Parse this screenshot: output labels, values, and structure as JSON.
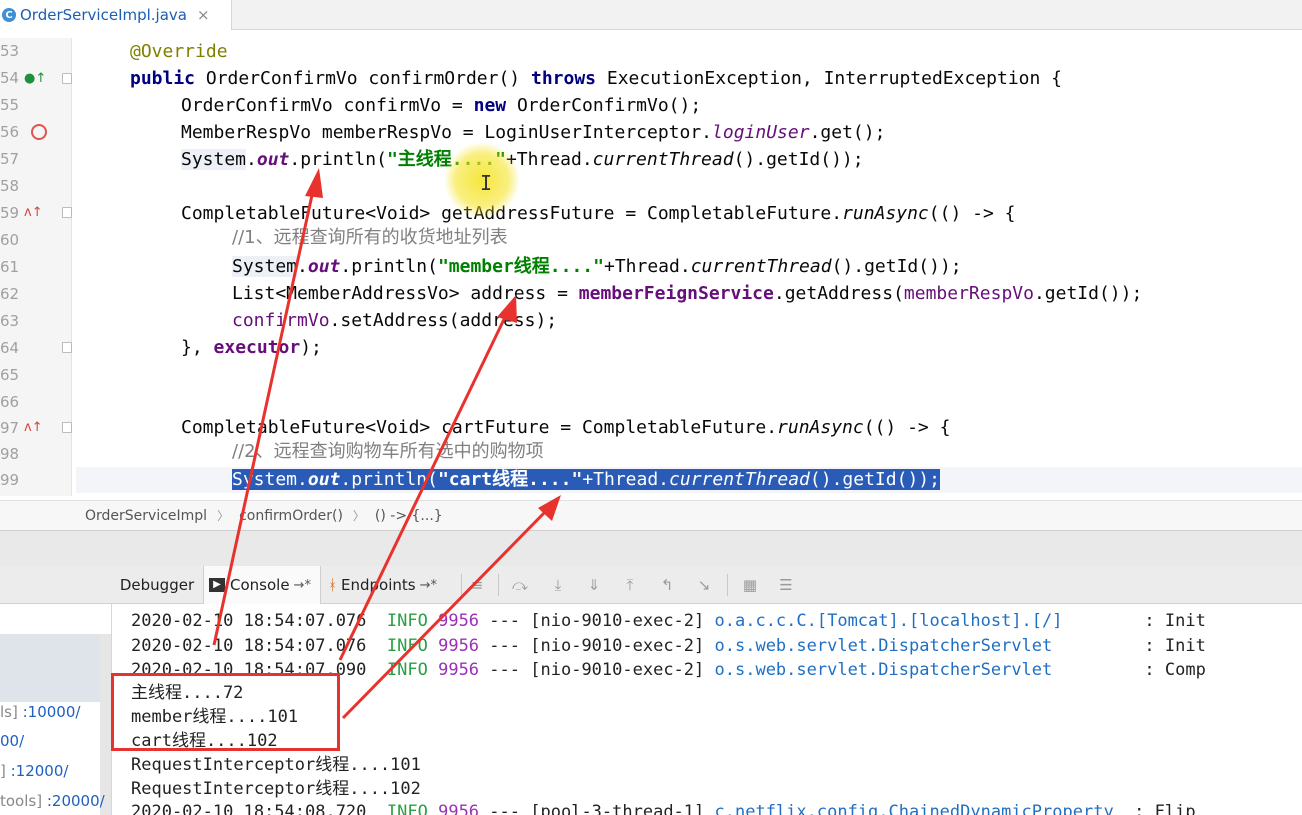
{
  "tab": {
    "icon": "C",
    "label": "OrderServiceImpl.java",
    "close": "×"
  },
  "gutter": {
    "numbers": [
      "53",
      "54",
      "55",
      "56",
      "57",
      "58",
      "59",
      "60",
      "61",
      "62",
      "63",
      "64",
      "65",
      "66",
      "97",
      "98",
      "99"
    ]
  },
  "code": {
    "l1": {
      "ann": "@Override"
    },
    "l2": {
      "kw1": "public",
      "t1": " OrderConfirmVo confirmOrder() ",
      "kw2": "throws",
      "t2": " ExecutionException, InterruptedException {"
    },
    "l3": {
      "t1": "OrderConfirmVo confirmVo = ",
      "kw": "new",
      "t2": " OrderConfirmVo();"
    },
    "l4": {
      "t1": "MemberRespVo memberRespVo = LoginUserInterceptor.",
      "it": "loginUser",
      "t2": ".get();"
    },
    "l5": {
      "sys": "System",
      "dot": ".",
      "fld": "out",
      "t1": ".println(",
      "str": "\"主线程....\"",
      "t2": "+Thread.",
      "it": "currentThread",
      "t3": "().getId());"
    },
    "l7": {
      "t1": "CompletableFuture<Void> getAddressFuture = CompletableFuture.",
      "it": "runAsync",
      "t2": "(() -> {"
    },
    "l8": {
      "cmt": "//1、远程查询所有的收货地址列表"
    },
    "l9": {
      "sys": "System",
      "dot": ".",
      "fld": "out",
      "t1": ".println(",
      "str": "\"member线程....\"",
      "t2": "+Thread.",
      "it": "currentThread",
      "t3": "().getId());"
    },
    "l10": {
      "t1": "List<MemberAddressVo> address = ",
      "svc": "memberFeignService",
      "t2": ".getAddress(",
      "mv": "memberRespVo",
      "t3": ".getId());"
    },
    "l11": {
      "cv": "confirmVo",
      "t1": ".setAddress(address);"
    },
    "l12": {
      "t1": "}, ",
      "ex": "executor",
      "t2": ");"
    },
    "l14": {
      "t1": "CompletableFuture<Void> cartFuture = CompletableFuture.",
      "it": "runAsync",
      "t2": "(() -> {"
    },
    "l15": {
      "cmt": "//2、远程查询购物车所有选中的购物项"
    },
    "l16": {
      "sys": "System",
      "dot": ".",
      "fld": "out",
      "t1": ".println(",
      "str": "\"cart线程....\"",
      "t2": "+Thread.",
      "it": "currentThread",
      "t3": "().getId());"
    }
  },
  "breadcrumb": [
    "OrderServiceImpl",
    "confirmOrder()",
    "() -> {...}"
  ],
  "debug_tabs": {
    "debugger": "Debugger",
    "console": "Console",
    "console_pin": "→*",
    "endpoints": "Endpoints",
    "endpoints_pin": "→*"
  },
  "services": [
    {
      "prefix": "ls] ",
      "port": ":10000/"
    },
    {
      "prefix": "",
      "port": "00/"
    },
    {
      "prefix": "] ",
      "port": ":12000/"
    },
    {
      "prefix": "tools] ",
      "port": ":20000/"
    }
  ],
  "console": {
    "logs": [
      {
        "time": "2020-02-10 18:54:07.076",
        "level": "INFO",
        "pid": "9956",
        "sep": "---",
        "thread": "[nio-9010-exec-2]",
        "logger": "o.a.c.c.C.[Tomcat].[localhost].[/]",
        "msg": ": Init"
      },
      {
        "time": "2020-02-10 18:54:07.076",
        "level": "INFO",
        "pid": "9956",
        "sep": "---",
        "thread": "[nio-9010-exec-2]",
        "logger": "o.s.web.servlet.DispatcherServlet",
        "msg": ": Init"
      },
      {
        "time": "2020-02-10 18:54:07.090",
        "level": "INFO",
        "pid": "9956",
        "sep": "---",
        "thread": "[nio-9010-exec-2]",
        "logger": "o.s.web.servlet.DispatcherServlet",
        "msg": ": Comp"
      }
    ],
    "output": [
      "主线程....72",
      "member线程....101",
      "cart线程....102",
      "RequestInterceptor线程....101",
      "RequestInterceptor线程....102"
    ],
    "last_log": {
      "time": "2020-02-10 18:54:08.720",
      "level": "INFO",
      "pid": "9956",
      "sep": "---",
      "thread": "[pool-3-thread-1]",
      "logger": "c.netflix.config.ChainedDynamicProperty",
      "msg": ": Flip"
    }
  },
  "colors": {
    "annotation_red": "#e8322e",
    "highlight_yellow": "#f5e21a",
    "selection": "#2a5bb6"
  }
}
